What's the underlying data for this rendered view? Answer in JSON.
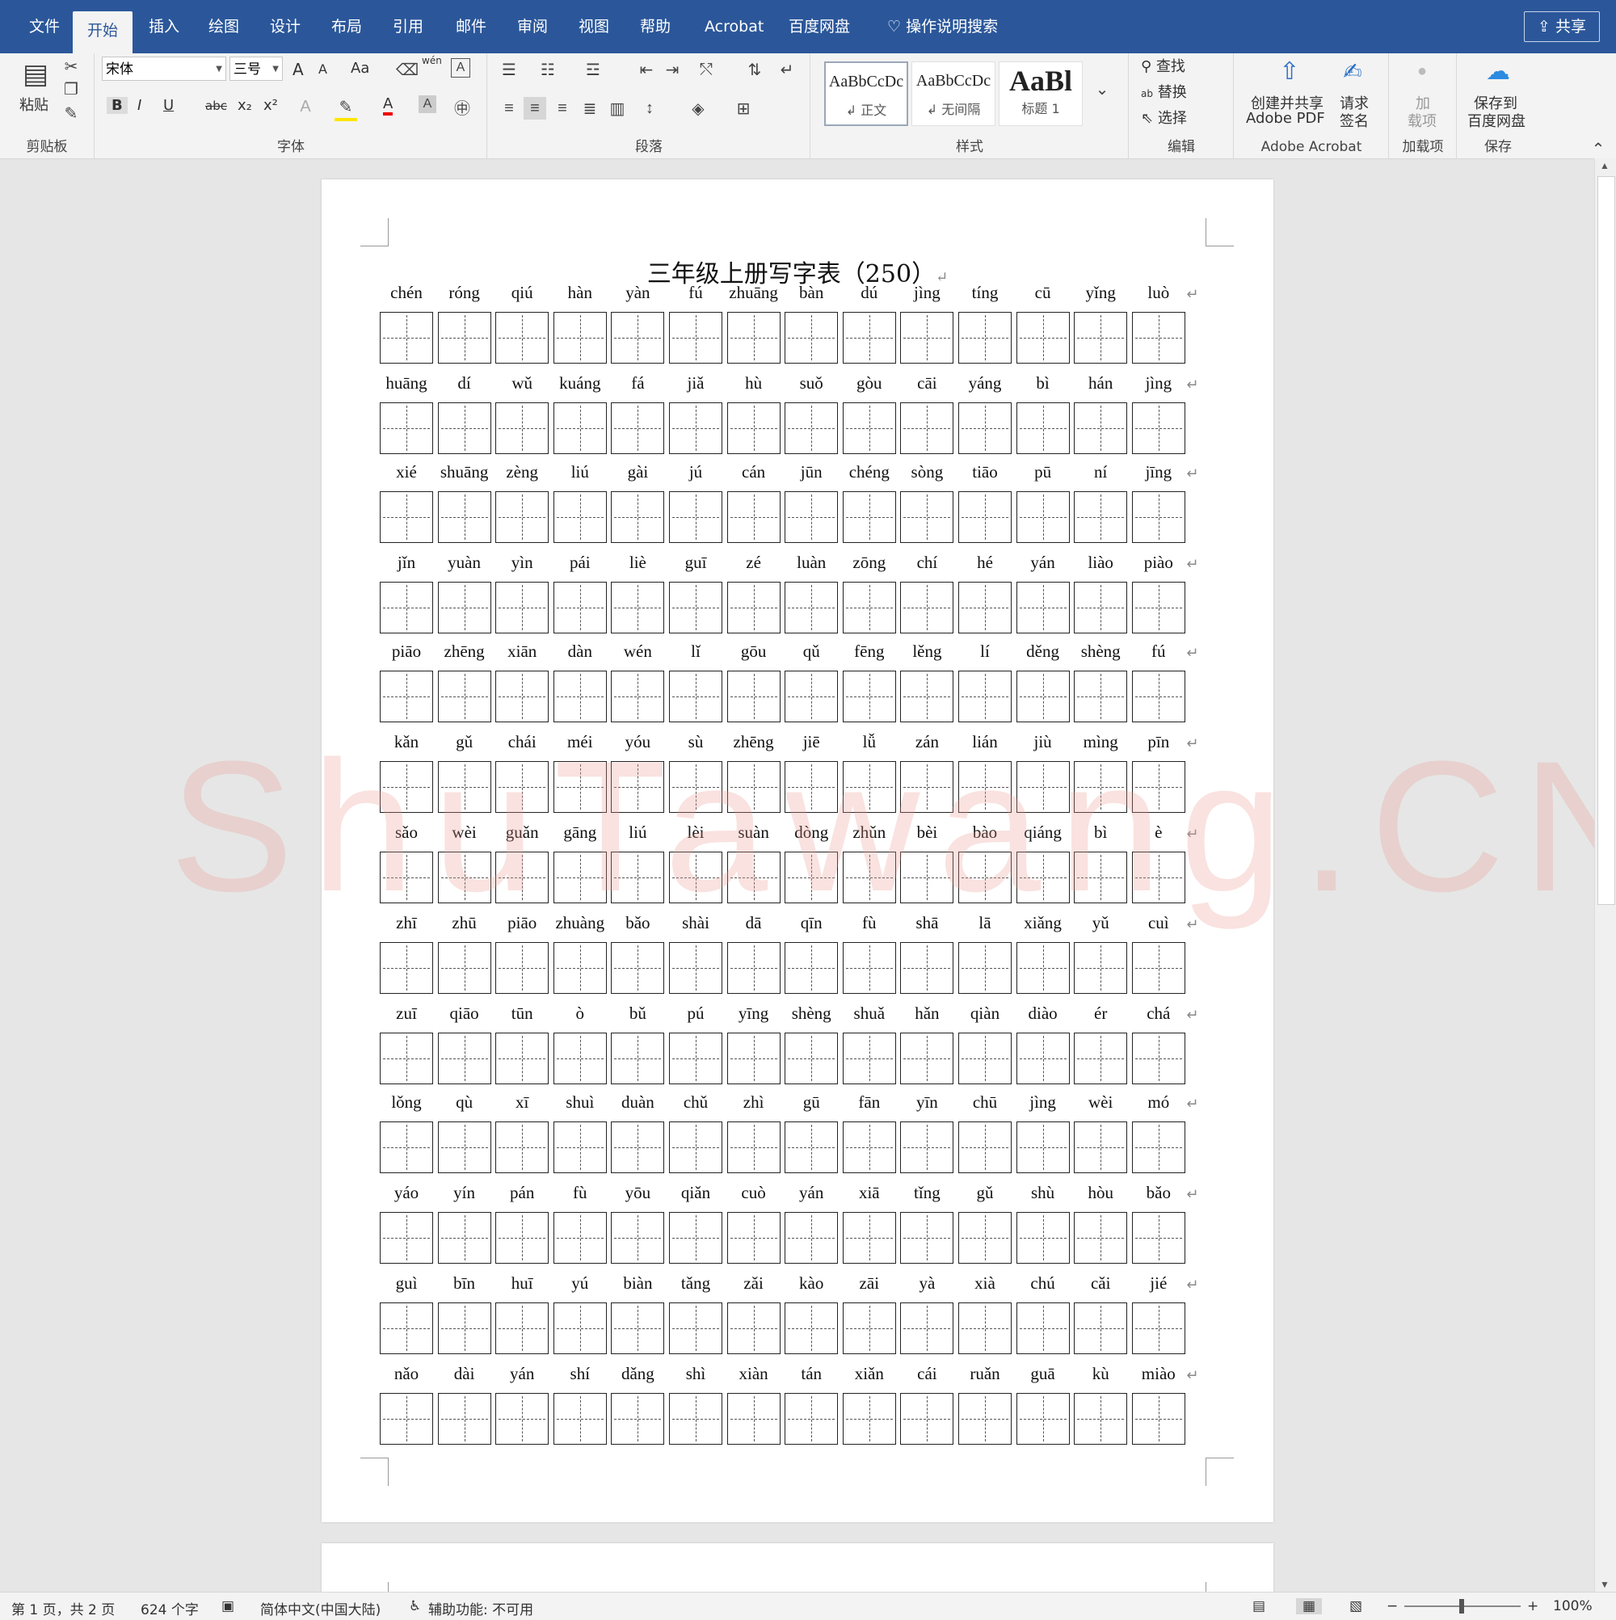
{
  "tabs": [
    "文件",
    "开始",
    "插入",
    "绘图",
    "设计",
    "布局",
    "引用",
    "邮件",
    "审阅",
    "视图",
    "帮助",
    "Acrobat",
    "百度网盘"
  ],
  "active_tab": "开始",
  "tell_me": "操作说明搜索",
  "share": "共享",
  "ribbon": {
    "clipboard": {
      "paste": "粘贴",
      "label": "剪贴板"
    },
    "font": {
      "name": "宋体",
      "size": "三号",
      "label": "字体",
      "grow": "A",
      "shrink": "A",
      "case": "Aa",
      "pinyin_hint": "wén",
      "bold": "B",
      "italic": "I",
      "underline": "U",
      "strike": "abc",
      "sub": "x₂",
      "sup": "x²",
      "font_color": "A"
    },
    "paragraph": {
      "label": "段落"
    },
    "styles": {
      "label": "样式",
      "items": [
        {
          "sample": "AaBbCcDc",
          "name": "↲ 正文"
        },
        {
          "sample": "AaBbCcDc",
          "name": "↲ 无间隔"
        },
        {
          "sample": "AaBl",
          "name": "标题 1"
        }
      ]
    },
    "editing": {
      "find": "查找",
      "replace": "替换",
      "select": "选择",
      "label": "编辑"
    },
    "acrobat": {
      "create": "创建并共享\nAdobe PDF",
      "create_l1": "创建并共享",
      "create_l2": "Adobe PDF",
      "sign_l1": "请求",
      "sign_l2": "签名",
      "label": "Adobe Acrobat"
    },
    "addins": {
      "l1": "加",
      "l2": "载项",
      "label": "加载项"
    },
    "save": {
      "l1": "保存到",
      "l2": "百度网盘",
      "label": "保存"
    }
  },
  "document": {
    "title": "三年级上册写字表（250）",
    "rows": [
      [
        "chén",
        "róng",
        "qiú",
        "hàn",
        "yàn",
        "fú",
        "zhuāng",
        "bàn",
        "dú",
        "jìng",
        "tíng",
        "cū",
        "yǐng",
        "luò"
      ],
      [
        "huāng",
        "dí",
        "wǔ",
        "kuáng",
        "fá",
        "jiǎ",
        "hù",
        "suǒ",
        "gòu",
        "cāi",
        "yáng",
        "bì",
        "hán",
        "jìng"
      ],
      [
        "xié",
        "shuāng",
        "zèng",
        "liú",
        "gài",
        "jú",
        "cán",
        "jūn",
        "chéng",
        "sòng",
        "tiāo",
        "pū",
        "ní",
        "jīng"
      ],
      [
        "jǐn",
        "yuàn",
        "yìn",
        "pái",
        "liè",
        "guī",
        "zé",
        "luàn",
        "zōng",
        "chí",
        "hé",
        "yán",
        "liào",
        "piào"
      ],
      [
        "piāo",
        "zhēng",
        "xiān",
        "dàn",
        "wén",
        "lǐ",
        "gōu",
        "qǔ",
        "fēng",
        "lěng",
        "lí",
        "děng",
        "shèng",
        "fú"
      ],
      [
        "kǎn",
        "gǔ",
        "chái",
        "méi",
        "yóu",
        "sù",
        "zhēng",
        "jiē",
        "lǚ",
        "zán",
        "lián",
        "jiù",
        "mìng",
        "pīn"
      ],
      [
        "sǎo",
        "wèi",
        "guǎn",
        "gāng",
        "liú",
        "lèi",
        "suàn",
        "dòng",
        "zhǔn",
        "bèi",
        "bào",
        "qiáng",
        "bì",
        "è"
      ],
      [
        "zhī",
        "zhū",
        "piāo",
        "zhuàng",
        "bǎo",
        "shài",
        "dā",
        "qīn",
        "fù",
        "shā",
        "lā",
        "xiǎng",
        "yǔ",
        "cuì"
      ],
      [
        "zuī",
        "qiāo",
        "tūn",
        "ò",
        "bǔ",
        "pú",
        "yīng",
        "shèng",
        "shuǎ",
        "hǎn",
        "qiàn",
        "diào",
        "ér",
        "chá"
      ],
      [
        "lǒng",
        "qù",
        "xī",
        "shuì",
        "duàn",
        "chǔ",
        "zhì",
        "gū",
        "fān",
        "yīn",
        "chū",
        "jìng",
        "wèi",
        "mó"
      ],
      [
        "yáo",
        "yín",
        "pán",
        "fù",
        "yōu",
        "qiǎn",
        "cuò",
        "yán",
        "xiā",
        "tǐng",
        "gǔ",
        "shù",
        "hòu",
        "bǎo"
      ],
      [
        "guì",
        "bīn",
        "huī",
        "yú",
        "biàn",
        "tǎng",
        "zǎi",
        "kào",
        "zāi",
        "yà",
        "xià",
        "chú",
        "cǎi",
        "jié"
      ],
      [
        "nǎo",
        "dài",
        "yán",
        "shí",
        "dǎng",
        "shì",
        "xiàn",
        "tán",
        "xiǎn",
        "cái",
        "ruǎn",
        "guā",
        "kù",
        "miào"
      ]
    ]
  },
  "watermark": "ShuTawang.CN",
  "status": {
    "page": "第 1 页，共 2 页",
    "words": "624 个字",
    "lang": "简体中文(中国大陆)",
    "accessibility": "辅助功能: 不可用",
    "zoom": "100%",
    "zoom_minus": "−",
    "zoom_plus": "+"
  },
  "colors": {
    "ribbon_blue": "#2b579a",
    "watermark": "#eb968c"
  }
}
